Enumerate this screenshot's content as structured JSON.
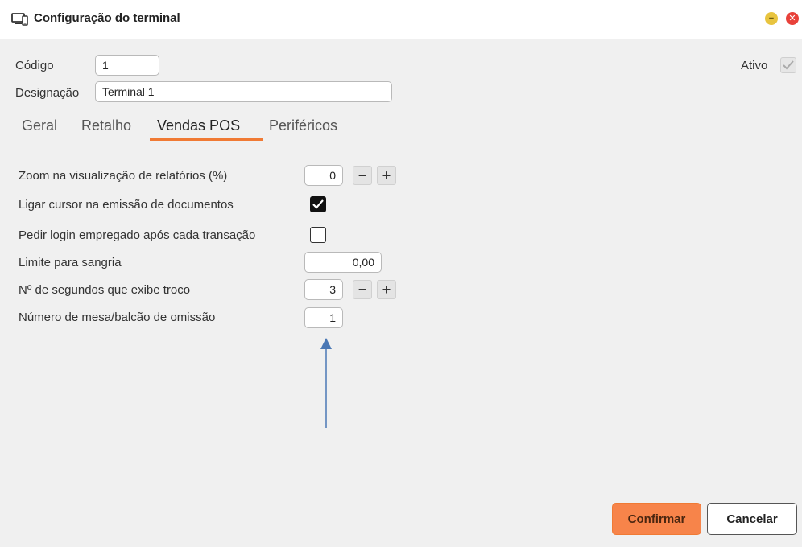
{
  "window": {
    "title": "Configuração do terminal",
    "title_icon": "terminal-config-icon",
    "minimize_icon": "minimize-icon",
    "close_icon": "close-icon",
    "minimize_glyph": "−",
    "close_glyph": "✕",
    "minimize_color": "#e8c43f",
    "close_color": "#e8413a"
  },
  "header": {
    "codigo_label": "Código",
    "codigo_value": "1",
    "designacao_label": "Designação",
    "designacao_value": "Terminal 1",
    "ativo_label": "Ativo",
    "ativo_checked": true
  },
  "tabs": [
    {
      "label": "Geral",
      "active": false
    },
    {
      "label": "Retalho",
      "active": false
    },
    {
      "label": "Vendas POS",
      "active": true
    },
    {
      "label": "Periféricos",
      "active": false
    }
  ],
  "accent_color": "#f07a34",
  "vendas_pos": {
    "zoom": {
      "label": "Zoom na visualização de relatórios (%)",
      "value": "0",
      "minus": "−",
      "plus": "+"
    },
    "ligar_cursor": {
      "label": "Ligar cursor na emissão de documentos",
      "checked": true
    },
    "pedir_login": {
      "label": "Pedir login empregado após cada transação",
      "checked": false
    },
    "limite_sangria": {
      "label": "Limite para sangria",
      "value": "0,00"
    },
    "segundos_troco": {
      "label": "Nº de segundos que exibe troco",
      "value": "3",
      "minus": "−",
      "plus": "+"
    },
    "numero_mesa": {
      "label": "Número de mesa/balcão de omissão",
      "value": "1"
    }
  },
  "annotation_arrow_color": "#4a78b5",
  "buttons": {
    "confirm": "Confirmar",
    "cancel": "Cancelar"
  }
}
